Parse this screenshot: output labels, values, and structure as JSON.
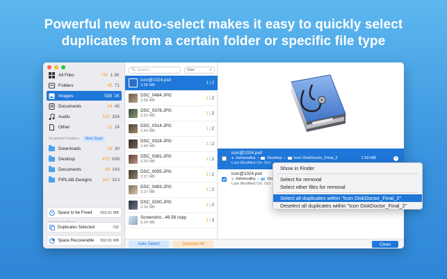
{
  "headline": {
    "line1": "Powerful new auto-select makes it easy to quickly select",
    "line2": "duplicates from a certain folder or specific file type"
  },
  "sidebar": {
    "categories": [
      {
        "label": "All Files",
        "count_selected": "732",
        "count_total": "1.3K",
        "icon": "grid-icon"
      },
      {
        "label": "Folders",
        "count_selected": "45",
        "count_total": "71",
        "icon": "folder-icon"
      },
      {
        "label": "Images",
        "count_selected": "539",
        "count_total": "1K",
        "icon": "image-icon",
        "selected": true
      },
      {
        "label": "Documents",
        "count_selected": "24",
        "count_total": "45",
        "icon": "document-icon"
      },
      {
        "label": "Audio",
        "count_selected": "102",
        "count_total": "204",
        "icon": "music-icon"
      },
      {
        "label": "Other",
        "count_selected": "21",
        "count_total": "24",
        "icon": "file-icon"
      }
    ],
    "scanned_title": "Scanned Folders",
    "new_scan_label": "New Scan",
    "scanned": [
      {
        "label": "Downloads",
        "count_selected": "16",
        "count_total": "30"
      },
      {
        "label": "Desktop",
        "count_selected": "470",
        "count_total": "938"
      },
      {
        "label": "Documents",
        "count_selected": "99",
        "count_total": "143"
      },
      {
        "label": "FIPLAB-Designs",
        "count_selected": "167",
        "count_total": "313"
      }
    ],
    "stats_title": "Clean Up Stats",
    "stats": [
      {
        "label": "Space to be Freed",
        "value": "502.61 MB"
      },
      {
        "label": "Duplicates Selected",
        "value": "732"
      },
      {
        "label": "Space Recoverable",
        "value": "502.61 MB"
      }
    ]
  },
  "list": {
    "search_placeholder": "Search...",
    "sort_label": "Size",
    "files": [
      {
        "name": "icon@1024.psd",
        "size": "3.98 MB",
        "sel": "1",
        "total": "2",
        "selected": true
      },
      {
        "name": "DSC_0484.JPG",
        "size": "3.58 MB",
        "sel": "1",
        "total": "2"
      },
      {
        "name": "DSC_0378.JPG",
        "size": "3.52 MB",
        "sel": "1",
        "total": "2"
      },
      {
        "name": "DSC_0314.JPG",
        "size": "3.49 MB",
        "sel": "1",
        "total": "2"
      },
      {
        "name": "DSC_0324.JPG",
        "size": "3.48 MB",
        "sel": "1",
        "total": "2"
      },
      {
        "name": "DSC_0381.JPG",
        "size": "3.39 MB",
        "sel": "1",
        "total": "2"
      },
      {
        "name": "DSC_0055.JPG",
        "size": "3.37 MB",
        "sel": "1",
        "total": "2"
      },
      {
        "name": "DSC_0483.JPG",
        "size": "3.37 MB",
        "sel": "1",
        "total": "2"
      },
      {
        "name": "DSC_0200.JPG",
        "size": "3.34 MB",
        "sel": "1",
        "total": "2"
      },
      {
        "name": "Screensho...46.58 copy",
        "size": "3.34 MB",
        "sel": "2",
        "total": "3"
      }
    ],
    "auto_select_label": "Auto Select",
    "deselect_all_label": "Deselect All"
  },
  "detail": {
    "duplicates": [
      {
        "name": "icon@1024.psd",
        "user": "rishimodha",
        "path1": "Desktop",
        "path2": "Icon DiskDoctor_Final_2",
        "modified": "Last Modified On: Oct",
        "size": "1.99 MB",
        "checked": false,
        "selected": true
      },
      {
        "name": "icon@1024.psd",
        "user": "rishimodha",
        "path1": "Dro",
        "path2": "",
        "modified": "Last Modified On: Oct",
        "size": "",
        "checked": true,
        "selected": false
      }
    ],
    "menu": [
      {
        "label": "Show in Finder"
      },
      {
        "label": "Select for removal"
      },
      {
        "label": "Select other files for removal"
      },
      {
        "label": "Select all duplicates within \"Icon DiskDoctor_Final_2\"",
        "highlighted": true
      },
      {
        "label": "Deselect all duplicates within \"Icon DiskDoctor_Final_2\""
      }
    ],
    "clean_label": "Clean"
  },
  "colors": {
    "accent": "#1f77d9",
    "orange": "#f29a1a",
    "background_top": "#5db7ee",
    "background_bottom": "#2f86d8"
  }
}
